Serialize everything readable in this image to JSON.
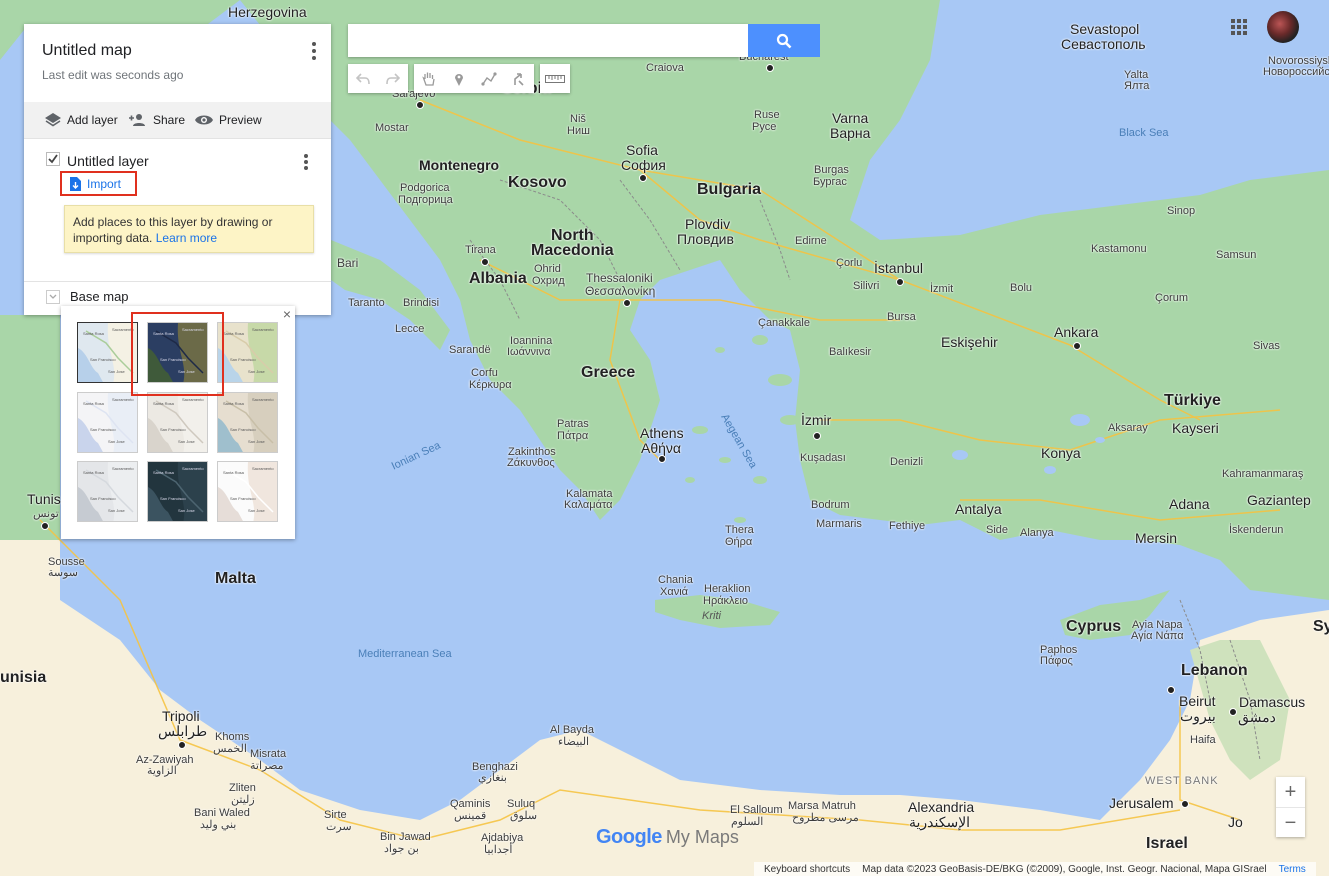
{
  "map": {
    "colors": {
      "sea": "#a8c8f5",
      "land": "#a8d8a8",
      "desert": "#f6efd8",
      "border": "#888888",
      "road": "#f6c94a"
    },
    "labels": [
      {
        "text": "Herzegovina",
        "cls": "city"
      },
      {
        "text": "Serbia",
        "cls": "country"
      },
      {
        "text": "Sarajevo",
        "cls": "small"
      },
      {
        "text": "Craiova",
        "cls": "small"
      },
      {
        "text": "Bucharest",
        "cls": "small"
      },
      {
        "text": "Sevastopol",
        "cls": "city"
      },
      {
        "text": "Севастополь",
        "cls": "city"
      },
      {
        "text": "Novorossiysk",
        "cls": "small"
      },
      {
        "text": "Новороссийск",
        "cls": "small"
      },
      {
        "text": "Yalta",
        "cls": "small"
      },
      {
        "text": "Ялта",
        "cls": "small"
      },
      {
        "text": "Mostar",
        "cls": "small"
      },
      {
        "text": "Niš",
        "cls": "small"
      },
      {
        "text": "Ниш",
        "cls": "small"
      },
      {
        "text": "Ruse",
        "cls": "small"
      },
      {
        "text": "Русе",
        "cls": "small"
      },
      {
        "text": "Varna",
        "cls": "city"
      },
      {
        "text": "Варна",
        "cls": "city"
      },
      {
        "text": "Black Sea",
        "cls": "sea"
      },
      {
        "text": "Montenegro",
        "cls": "country"
      },
      {
        "text": "Sofia",
        "cls": "city"
      },
      {
        "text": "София",
        "cls": "city"
      },
      {
        "text": "Podgorica",
        "cls": "small"
      },
      {
        "text": "Подгорица",
        "cls": "small"
      },
      {
        "text": "Kosovo",
        "cls": "country"
      },
      {
        "text": "Bulgaria",
        "cls": "country"
      },
      {
        "text": "Burgas",
        "cls": "small"
      },
      {
        "text": "Бургас",
        "cls": "small"
      },
      {
        "text": "Sinop",
        "cls": "small"
      },
      {
        "text": "Tirana",
        "cls": "small"
      },
      {
        "text": "North",
        "cls": "country"
      },
      {
        "text": "Macedonia",
        "cls": "country"
      },
      {
        "text": "Plovdiv",
        "cls": "city"
      },
      {
        "text": "Пловдив",
        "cls": "city"
      },
      {
        "text": "Edirne",
        "cls": "small"
      },
      {
        "text": "Kastamonu",
        "cls": "small"
      },
      {
        "text": "Samsun",
        "cls": "small"
      },
      {
        "text": "Bari",
        "cls": "small"
      },
      {
        "text": "Albania",
        "cls": "country"
      },
      {
        "text": "Ohrid",
        "cls": "small"
      },
      {
        "text": "Охрид",
        "cls": "small"
      },
      {
        "text": "Thessaloniki",
        "cls": "small"
      },
      {
        "text": "Θεσσαλονίκη",
        "cls": "small"
      },
      {
        "text": "Çorlu",
        "cls": "small"
      },
      {
        "text": "İstanbul",
        "cls": "city"
      },
      {
        "text": "Silivri",
        "cls": "small"
      },
      {
        "text": "İzmit",
        "cls": "small"
      },
      {
        "text": "Bolu",
        "cls": "small"
      },
      {
        "text": "Çorum",
        "cls": "small"
      },
      {
        "text": "Taranto",
        "cls": "small"
      },
      {
        "text": "Brindisi",
        "cls": "small"
      },
      {
        "text": "Lecce",
        "cls": "small"
      },
      {
        "text": "Bursa",
        "cls": "small"
      },
      {
        "text": "Çanakkale",
        "cls": "small"
      },
      {
        "text": "Ankara",
        "cls": "city"
      },
      {
        "text": "Eskişehir",
        "cls": "city"
      },
      {
        "text": "Balıkesir",
        "cls": "small"
      },
      {
        "text": "Sarandë",
        "cls": "small"
      },
      {
        "text": "Ioannina",
        "cls": "small"
      },
      {
        "text": "Ιωάννινα",
        "cls": "small"
      },
      {
        "text": "Corfu",
        "cls": "small"
      },
      {
        "text": "Κέρκυρα",
        "cls": "small"
      },
      {
        "text": "Sivas",
        "cls": "small"
      },
      {
        "text": "Greece",
        "cls": "country"
      },
      {
        "text": "Türkiye",
        "cls": "country"
      },
      {
        "text": "Kayseri",
        "cls": "city"
      },
      {
        "text": "İzmir",
        "cls": "city"
      },
      {
        "text": "Patras",
        "cls": "small"
      },
      {
        "text": "Πάτρα",
        "cls": "small"
      },
      {
        "text": "Aksaray",
        "cls": "small"
      },
      {
        "text": "Ionian Sea",
        "cls": "sea"
      },
      {
        "text": "Aegean Sea",
        "cls": "sea"
      },
      {
        "text": "Athens",
        "cls": "city"
      },
      {
        "text": "Αθήνα",
        "cls": "city"
      },
      {
        "text": "Zakinthos",
        "cls": "small"
      },
      {
        "text": "Ζάκυνθος",
        "cls": "small"
      },
      {
        "text": "Kuşadası",
        "cls": "small"
      },
      {
        "text": "Denizli",
        "cls": "small"
      },
      {
        "text": "Konya",
        "cls": "city"
      },
      {
        "text": "Kahramanmaraş",
        "cls": "small"
      },
      {
        "text": "Tunis",
        "cls": "city"
      },
      {
        "text": "تونس",
        "cls": "small"
      },
      {
        "text": "Kalamata",
        "cls": "small"
      },
      {
        "text": "Καλαμάτα",
        "cls": "small"
      },
      {
        "text": "Bodrum",
        "cls": "small"
      },
      {
        "text": "Marmaris",
        "cls": "small"
      },
      {
        "text": "Fethiye",
        "cls": "small"
      },
      {
        "text": "Antalya",
        "cls": "city"
      },
      {
        "text": "Adana",
        "cls": "city"
      },
      {
        "text": "Gaziantep",
        "cls": "city"
      },
      {
        "text": "Side",
        "cls": "small"
      },
      {
        "text": "Alanya",
        "cls": "small"
      },
      {
        "text": "İskenderun",
        "cls": "small"
      },
      {
        "text": "Thera",
        "cls": "small"
      },
      {
        "text": "Θήρα",
        "cls": "small"
      },
      {
        "text": "Mersin",
        "cls": "city"
      },
      {
        "text": "Sousse",
        "cls": "small"
      },
      {
        "text": "سوسة",
        "cls": "small"
      },
      {
        "text": "Malta",
        "cls": "country"
      },
      {
        "text": "Chania",
        "cls": "small"
      },
      {
        "text": "Χανιά",
        "cls": "small"
      },
      {
        "text": "Heraklion",
        "cls": "small"
      },
      {
        "text": "Ηράκλειο",
        "cls": "small"
      },
      {
        "text": "Kriti",
        "cls": "sea"
      },
      {
        "text": "Cyprus",
        "cls": "country"
      },
      {
        "text": "Ayia Napa",
        "cls": "small"
      },
      {
        "text": "Αγία Νάπα",
        "cls": "small"
      },
      {
        "text": "Sy",
        "cls": "country"
      },
      {
        "text": "Mediterranean Sea",
        "cls": "sea"
      },
      {
        "text": "Paphos",
        "cls": "small"
      },
      {
        "text": "Πάφος",
        "cls": "small"
      },
      {
        "text": "Lebanon",
        "cls": "country"
      },
      {
        "text": "unisia",
        "cls": "country"
      },
      {
        "text": "Beirut",
        "cls": "city"
      },
      {
        "text": "بيروت",
        "cls": "city"
      },
      {
        "text": "Damascus",
        "cls": "city"
      },
      {
        "text": "دمشق",
        "cls": "city"
      },
      {
        "text": "Tripoli",
        "cls": "city"
      },
      {
        "text": "طرابلس",
        "cls": "city"
      },
      {
        "text": "Khoms",
        "cls": "small"
      },
      {
        "text": "الخمس",
        "cls": "small"
      },
      {
        "text": "Al Bayda",
        "cls": "small"
      },
      {
        "text": "البيضاء",
        "cls": "small"
      },
      {
        "text": "Haifa",
        "cls": "small"
      },
      {
        "text": "Az-Zawiyah",
        "cls": "small"
      },
      {
        "text": "الزاوية",
        "cls": "small"
      },
      {
        "text": "Misrata",
        "cls": "small"
      },
      {
        "text": "مصراتة",
        "cls": "small"
      },
      {
        "text": "Benghazi",
        "cls": "small"
      },
      {
        "text": "بنغازي",
        "cls": "small"
      },
      {
        "text": "WEST BANK",
        "cls": "small"
      },
      {
        "text": "Zliten",
        "cls": "small"
      },
      {
        "text": "زليتن",
        "cls": "small"
      },
      {
        "text": "Bani Waled",
        "cls": "small"
      },
      {
        "text": "بني وليد",
        "cls": "small"
      },
      {
        "text": "Sirte",
        "cls": "small"
      },
      {
        "text": "سرت",
        "cls": "small"
      },
      {
        "text": "Qaminis",
        "cls": "small"
      },
      {
        "text": "قمينس",
        "cls": "small"
      },
      {
        "text": "Suluq",
        "cls": "small"
      },
      {
        "text": "سلوق",
        "cls": "small"
      },
      {
        "text": "El Salloum",
        "cls": "small"
      },
      {
        "text": "السلوم",
        "cls": "small"
      },
      {
        "text": "Marsa Matruh",
        "cls": "small"
      },
      {
        "text": "مرسى مطروح",
        "cls": "small"
      },
      {
        "text": "Alexandria",
        "cls": "city"
      },
      {
        "text": "الإسكندرية",
        "cls": "city"
      },
      {
        "text": "Jerusalem",
        "cls": "city"
      },
      {
        "text": "Jo",
        "cls": "city"
      },
      {
        "text": "Bin Jawad",
        "cls": "small"
      },
      {
        "text": "بن جواد",
        "cls": "small"
      },
      {
        "text": "Ajdabiya",
        "cls": "small"
      },
      {
        "text": "أجدابيا",
        "cls": "small"
      },
      {
        "text": "Israel",
        "cls": "country"
      }
    ]
  },
  "panel": {
    "title": "Untitled map",
    "subtitle": "Last edit was seconds ago",
    "actions": {
      "add_layer": "Add layer",
      "share": "Share",
      "preview": "Preview"
    },
    "layer": {
      "name": "Untitled layer",
      "import_label": "Import",
      "tip_text": "Add places to this layer by drawing or importing data.",
      "tip_link": "Learn more"
    },
    "base_map_label": "Base map"
  },
  "chooser": {
    "close_glyph": "×",
    "thumbs": [
      {
        "style": "map",
        "selected": true
      },
      {
        "style": "satellite",
        "selected": false
      },
      {
        "style": "terrain",
        "selected": false
      },
      {
        "style": "light-political",
        "selected": false
      },
      {
        "style": "mono-city",
        "selected": false
      },
      {
        "style": "simple-atlas",
        "selected": false
      },
      {
        "style": "light-landmass",
        "selected": false
      },
      {
        "style": "dark-landmass",
        "selected": false
      },
      {
        "style": "whitewater",
        "selected": false
      }
    ],
    "thumb_labels": [
      "Santa Rosa",
      "Sacramento",
      "San Francisco",
      "San Jose"
    ]
  },
  "search": {
    "value": "",
    "placeholder": ""
  },
  "toolbar": {
    "icons": [
      "undo-icon",
      "redo-icon",
      "hand-icon",
      "marker-icon",
      "draw-line-icon",
      "directions-icon",
      "ruler-icon"
    ]
  },
  "zoom": {
    "in": "+",
    "out": "−"
  },
  "logo": {
    "google": "Google",
    "mymaps": "My Maps"
  },
  "footer": {
    "shortcuts": "Keyboard shortcuts",
    "mapdata": "Map data ©2023 GeoBasis-DE/BKG (©2009), Google, Inst. Geogr. Nacional, Mapa GISrael",
    "terms": "Terms"
  }
}
